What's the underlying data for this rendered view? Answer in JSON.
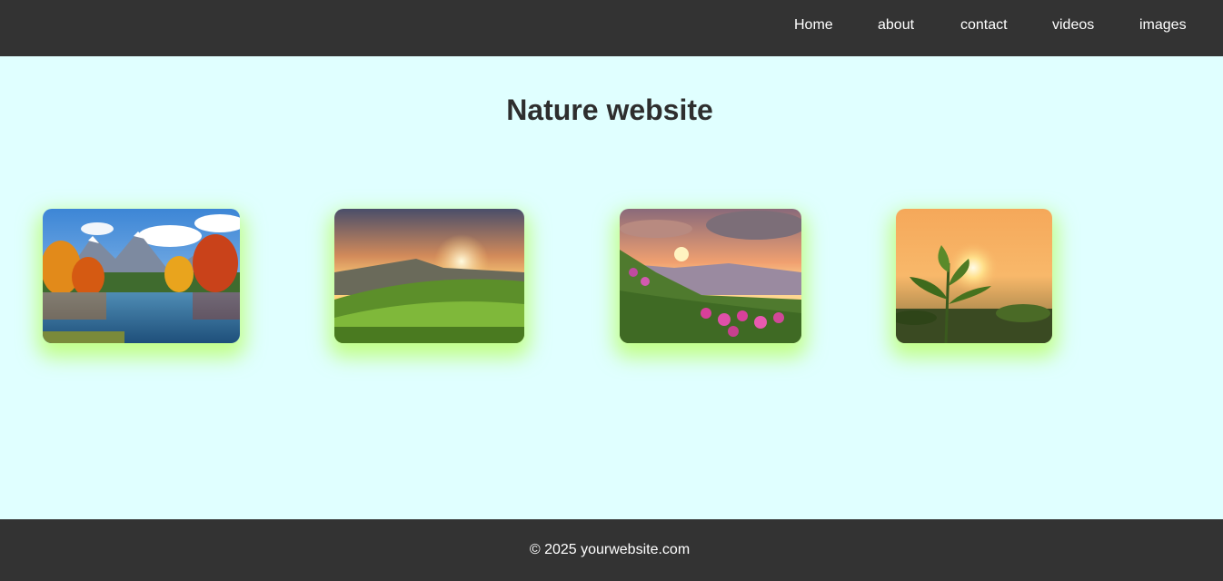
{
  "nav": {
    "items": [
      {
        "label": "Home"
      },
      {
        "label": "about"
      },
      {
        "label": "contact"
      },
      {
        "label": "videos"
      },
      {
        "label": "images"
      }
    ]
  },
  "main": {
    "title": "Nature website",
    "gallery": [
      {
        "image": "autumn-lake-mountains"
      },
      {
        "image": "sunset-green-hills"
      },
      {
        "image": "sunset-mountain-flowers"
      },
      {
        "image": "sunrise-tea-sprout"
      }
    ]
  },
  "footer": {
    "copyright": "© 2025 yourwebsite.com"
  },
  "colors": {
    "nav_bg": "#333333",
    "page_bg": "#e0ffff",
    "card_glow": "#aaff28"
  }
}
